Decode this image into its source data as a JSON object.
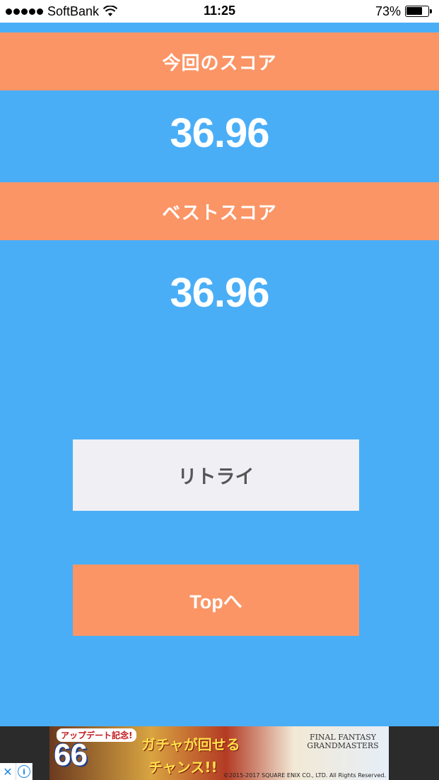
{
  "status_bar": {
    "carrier": "SoftBank",
    "time": "11:25",
    "battery": "73%",
    "battery_level": 0.73
  },
  "current_score": {
    "label": "今回のスコア",
    "value": "36.96"
  },
  "best_score": {
    "label": "ベストスコア",
    "value": "36.96"
  },
  "buttons": {
    "retry": "リトライ",
    "top": "Topへ"
  },
  "ad": {
    "badge": "アップデート記念!",
    "big_text": "66",
    "line1": "ガチャが回せる",
    "line2": "チャンス!!",
    "logo_text": "FINAL FANTASY GRANDMASTERS",
    "copyright": "©2015-2017 SQUARE ENIX CO., LTD. All Rights Reserved."
  },
  "colors": {
    "background": "#4aaef7",
    "accent": "#fb9566",
    "retry_button": "#efeff4"
  }
}
